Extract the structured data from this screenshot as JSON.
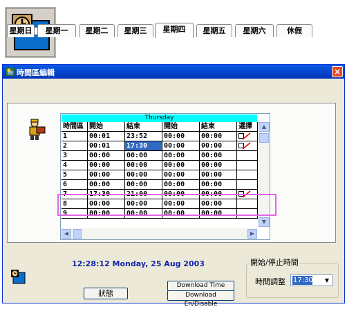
{
  "window": {
    "title": "時間區編輯",
    "close_symbol": "×"
  },
  "tabs": [
    {
      "label": "星期日",
      "active": false
    },
    {
      "label": "星期一",
      "active": false
    },
    {
      "label": "星期二",
      "active": false
    },
    {
      "label": "星期三",
      "active": false
    },
    {
      "label": "星期四",
      "active": true
    },
    {
      "label": "星期五",
      "active": false
    },
    {
      "label": "星期六",
      "active": false
    },
    {
      "label": "休假",
      "active": false
    }
  ],
  "grid": {
    "day": "Thursday",
    "headers": [
      "時間區",
      "開始",
      "結束",
      "開始",
      "結束",
      "選擇"
    ],
    "rows": [
      {
        "zone": "1",
        "start1": "00:01",
        "end1": "23:52",
        "start2": "00:00",
        "end2": "00:00",
        "selected": true
      },
      {
        "zone": "2",
        "start1": "00:01",
        "end1": "17:30",
        "start2": "00:00",
        "end2": "00:00",
        "selected": true
      },
      {
        "zone": "3",
        "start1": "00:00",
        "end1": "00:00",
        "start2": "00:00",
        "end2": "00:00",
        "selected": false
      },
      {
        "zone": "4",
        "start1": "00:00",
        "end1": "00:00",
        "start2": "00:00",
        "end2": "00:00",
        "selected": false
      },
      {
        "zone": "5",
        "start1": "00:00",
        "end1": "00:00",
        "start2": "00:00",
        "end2": "00:00",
        "selected": false
      },
      {
        "zone": "6",
        "start1": "00:00",
        "end1": "00:00",
        "start2": "00:00",
        "end2": "00:00",
        "selected": false
      },
      {
        "zone": "7",
        "start1": "17:30",
        "end1": "21:00",
        "start2": "00:00",
        "end2": "00:00",
        "selected": true
      },
      {
        "zone": "8",
        "start1": "00:00",
        "end1": "00:00",
        "start2": "00:00",
        "end2": "00:00",
        "selected": false
      },
      {
        "zone": "9",
        "start1": "00:00",
        "end1": "00:00",
        "start2": "00:00",
        "end2": "00:00",
        "selected": false
      }
    ]
  },
  "bottom": {
    "datetime": "12:28:12 Monday, 25 Aug 2003",
    "status_button": "狀態",
    "download_timezone": "Download Time Zone",
    "download_endisable": "Download En/Disable",
    "group_title": "開始/停止時間",
    "adjust_label": "時間調整",
    "adjust_value": "17:30"
  },
  "colors": {
    "title_bar": "#0348d0",
    "accent_cyan": "#00ffff",
    "selection": "#316ac5",
    "highlight_box": "#e264e8",
    "datetime_text": "#1424a8"
  }
}
